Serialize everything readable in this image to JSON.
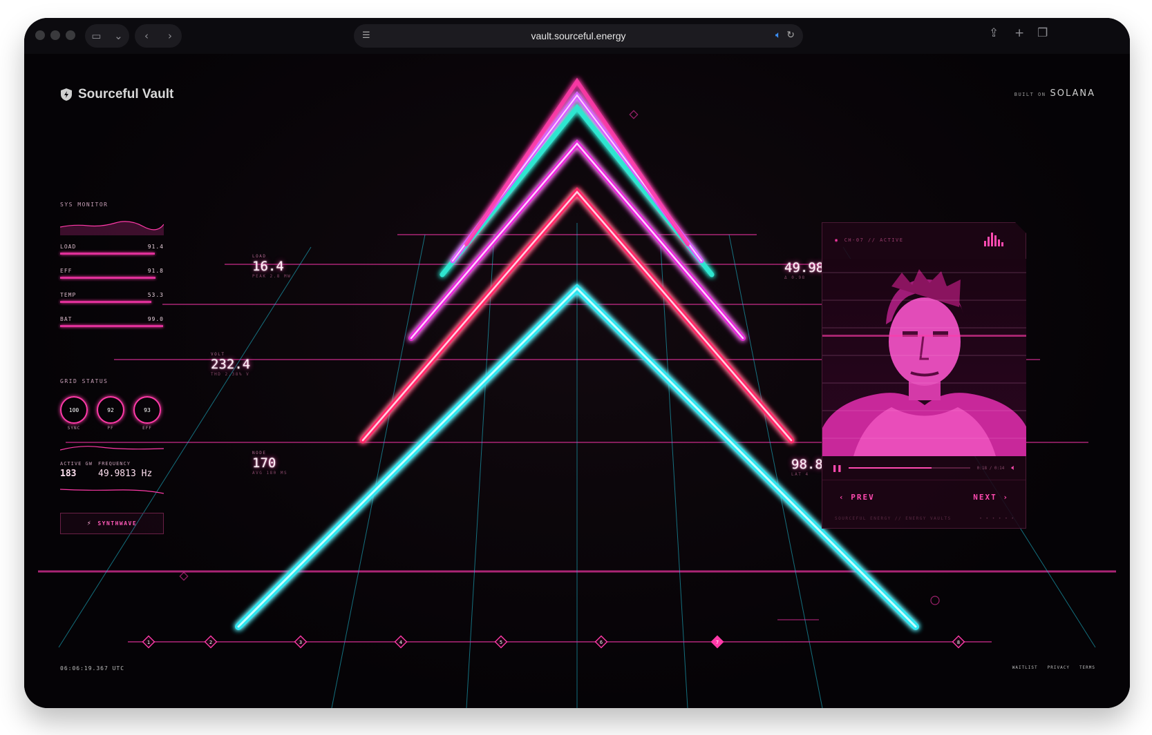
{
  "browser": {
    "url": "vault.sourceful.energy"
  },
  "brand": {
    "name": "Sourceful Vault",
    "built_on_label": "BUILT ON",
    "built_on_name": "SOLANA"
  },
  "sys_monitor": {
    "title": "SYS MONITOR",
    "metrics": [
      {
        "label": "LOAD",
        "value": "91.4",
        "level": 0.914
      },
      {
        "label": "EFF",
        "value": "91.8",
        "level": 0.918
      },
      {
        "label": "TEMP",
        "value": "53.3",
        "level": 0.88
      },
      {
        "label": "BAT",
        "value": "99.0",
        "level": 0.99
      }
    ]
  },
  "grid_status": {
    "title": "GRID STATUS",
    "gauges": [
      {
        "value": "100",
        "label": "SYNC"
      },
      {
        "value": "92",
        "label": "PF"
      },
      {
        "value": "93",
        "label": "EFF"
      }
    ],
    "active_gw_label": "ACTIVE GW",
    "active_gw_value": "183",
    "frequency_label": "FREQUENCY",
    "frequency_value": "49.9813 Hz"
  },
  "synthwave_button": "SYNTHWAVE",
  "readouts": {
    "load": {
      "label": "LOAD",
      "value": "16.4",
      "sub": "PEAK 2.8 MW"
    },
    "volt": {
      "label": "VOLT",
      "value": "232.4",
      "sub": "THD 2.38% V"
    },
    "node": {
      "label": "NODE",
      "value": "170",
      "sub": "AVG 180 MS"
    },
    "freq": {
      "value": "49.98",
      "sub": "Δ 0.98"
    },
    "lat": {
      "value": "98.8",
      "sub": "LAT 4"
    }
  },
  "timeline": {
    "steps": [
      "1",
      "2",
      "3",
      "4",
      "5",
      "6",
      "7",
      "8"
    ],
    "active_step": "7"
  },
  "player": {
    "channel": "CH-07 // ACTIVE",
    "time": "0:18 / 0:14",
    "progress": 0.68,
    "prev_label": "PREV",
    "next_label": "NEXT",
    "footer": "SOURCEFUL ENERGY // ENERGY VAULTS",
    "footer_dots": "• • • • • •"
  },
  "footer": {
    "clock": "06:06:19.367 UTC",
    "links": [
      "WAITLIST",
      "PRIVACY",
      "TERMS"
    ]
  },
  "colors": {
    "accent": "#ff3aa8",
    "cyan": "#2ee6f0",
    "magenta": "#e62ad8",
    "red": "#ff2a6a"
  }
}
